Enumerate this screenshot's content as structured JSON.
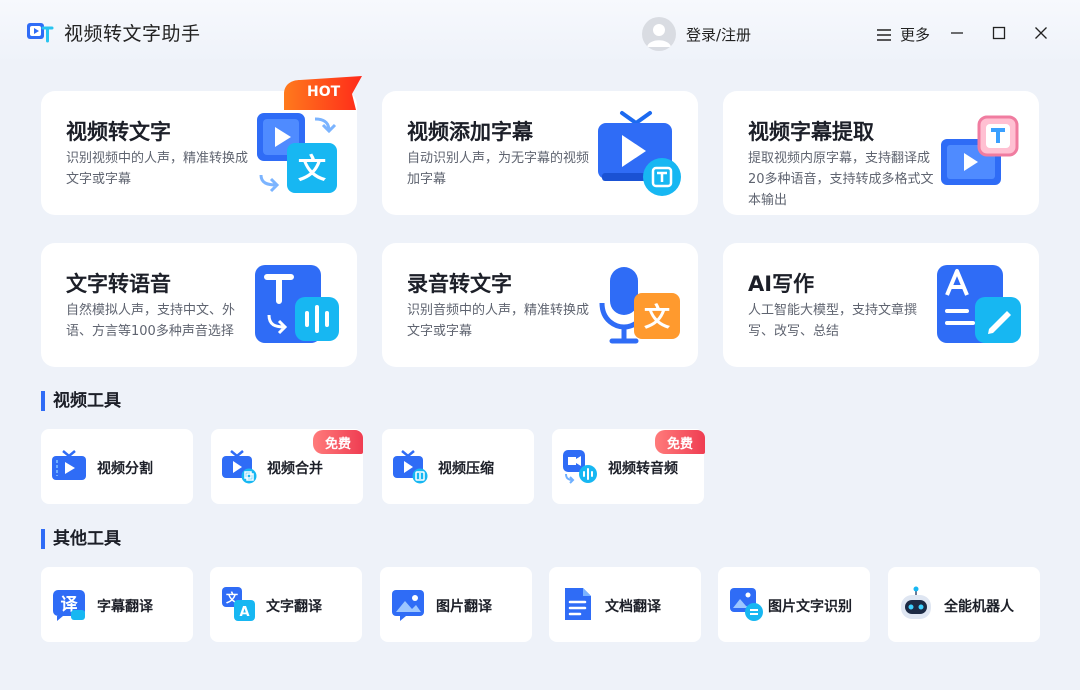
{
  "app": {
    "title": "视频转文字助手"
  },
  "header": {
    "login_label": "登录/注册",
    "more_label": "更多"
  },
  "feature_cards": [
    {
      "title": "视频转文字",
      "desc": "识别视频中的人声，精准转换成文字或字幕",
      "badge": "HOT"
    },
    {
      "title": "视频添加字幕",
      "desc": "自动识别人声，为无字幕的视频加字幕"
    },
    {
      "title": "视频字幕提取",
      "desc": "提取视频内原字幕，支持翻译成20多种语音，支持转成多格式文本输出"
    },
    {
      "title": "文字转语音",
      "desc": "自然模拟人声，支持中文、外语、方言等100多种声音选择"
    },
    {
      "title": "录音转文字",
      "desc": "识别音频中的人声，精准转换成文字或字幕"
    },
    {
      "title": "AI写作",
      "desc": "人工智能大模型，支持文章撰写、改写、总结"
    }
  ],
  "video_tools": {
    "title": "视频工具",
    "items": [
      {
        "label": "视频分割"
      },
      {
        "label": "视频合并",
        "badge": "免费"
      },
      {
        "label": "视频压缩"
      },
      {
        "label": "视频转音频",
        "badge": "免费"
      }
    ]
  },
  "other_tools": {
    "title": "其他工具",
    "items": [
      {
        "label": "字幕翻译"
      },
      {
        "label": "文字翻译"
      },
      {
        "label": "图片翻译"
      },
      {
        "label": "文档翻译"
      },
      {
        "label": "图片文字识别"
      },
      {
        "label": "全能机器人"
      }
    ]
  },
  "colors": {
    "accent": "#2f6cf6",
    "hot": "#ff4a1c",
    "free": "#ef3d52",
    "card_bg": "#ffffff",
    "page_bg": "#eef2f9"
  }
}
